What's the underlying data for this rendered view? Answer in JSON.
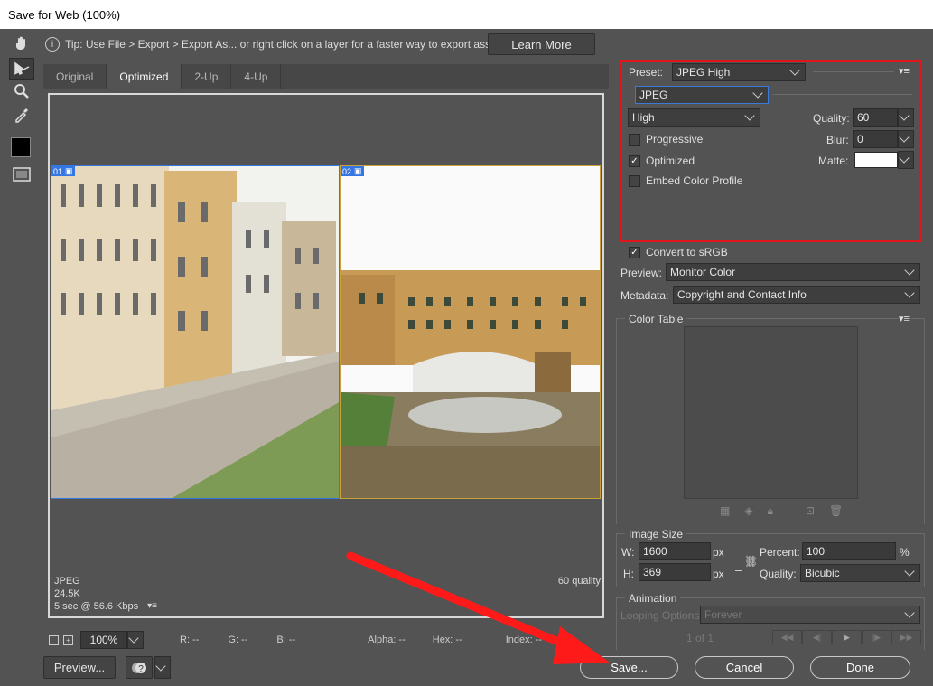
{
  "window": {
    "title": "Save for Web (100%)"
  },
  "tools": {
    "items": [
      "hand-tool",
      "slice-select-tool",
      "zoom-tool",
      "eyedropper-tool",
      "eyedropper-color",
      "toggle-slices"
    ]
  },
  "tip": {
    "text": "Tip: Use File > Export > Export As...  or right click on a layer for a faster way to export assets",
    "learn_more": "Learn More"
  },
  "tabs": [
    {
      "label": "Original"
    },
    {
      "label": "Optimized"
    },
    {
      "label": "2-Up"
    },
    {
      "label": "4-Up"
    }
  ],
  "panes": {
    "slice1": "01",
    "slice2": "02"
  },
  "image_info": {
    "format": "JPEG",
    "size": "24.5K",
    "time": "5 sec @ 56.6 Kbps",
    "quality": "60 quality"
  },
  "status": {
    "zoom": "100%",
    "r": "R: --",
    "g": "G: --",
    "b": "B: --",
    "alpha": "Alpha: --",
    "hex": "Hex: --",
    "index": "Index: --"
  },
  "settings": {
    "preset_label": "Preset:",
    "preset_value": "JPEG High",
    "format": "JPEG",
    "quality_level": "High",
    "quality_label": "Quality:",
    "quality_value": "60",
    "blur_label": "Blur:",
    "blur_value": "0",
    "matte_label": "Matte:",
    "progressive_label": "Progressive",
    "progressive_checked": false,
    "optimized_label": "Optimized",
    "optimized_checked": true,
    "embed_label": "Embed Color Profile",
    "embed_checked": false,
    "convert_label": "Convert to sRGB",
    "convert_checked": true,
    "preview_label": "Preview:",
    "preview_value": "Monitor Color",
    "metadata_label": "Metadata:",
    "metadata_value": "Copyright and Contact Info"
  },
  "color_table": {
    "title": "Color Table"
  },
  "image_size": {
    "title": "Image Size",
    "w_label": "W:",
    "w_value": "1600",
    "h_label": "H:",
    "h_value": "369",
    "unit": "px",
    "percent_label": "Percent:",
    "percent_value": "100",
    "percent_unit": "%",
    "quality_label": "Quality:",
    "quality_value": "Bicubic"
  },
  "animation": {
    "title": "Animation",
    "looping_label": "Looping Options:",
    "looping_value": "Forever",
    "frame": "1 of 1"
  },
  "buttons": {
    "preview": "Preview...",
    "save": "Save...",
    "cancel": "Cancel",
    "done": "Done"
  },
  "colors": {
    "highlight": "#e0141b",
    "arrow": "#ff1a1a",
    "slice": "#3476e3"
  }
}
